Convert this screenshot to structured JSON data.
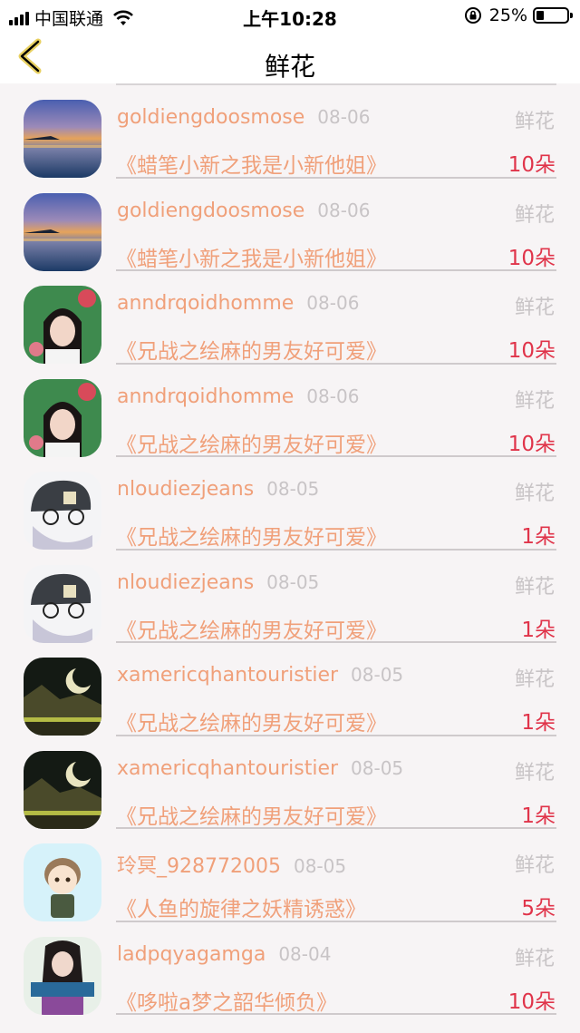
{
  "status": {
    "carrier": "中国联通",
    "time": "上午10:28",
    "battery": "25%",
    "battery_level": 0.25
  },
  "nav": {
    "title": "鲜花"
  },
  "items": [
    {
      "username": "goldiengdoosmose",
      "date": "08-06",
      "type": "鲜花",
      "title": "《蜡笔小新之我是小新他姐》",
      "count": "10朵",
      "avatar": "lake-sunset"
    },
    {
      "username": "goldiengdoosmose",
      "date": "08-06",
      "type": "鲜花",
      "title": "《蜡笔小新之我是小新他姐》",
      "count": "10朵",
      "avatar": "lake-sunset"
    },
    {
      "username": "anndrqoidhomme",
      "date": "08-06",
      "type": "鲜花",
      "title": "《兄战之绘麻的男友好可爱》",
      "count": "10朵",
      "avatar": "girl-flowers"
    },
    {
      "username": "anndrqoidhomme",
      "date": "08-06",
      "type": "鲜花",
      "title": "《兄战之绘麻的男友好可爱》",
      "count": "10朵",
      "avatar": "girl-flowers"
    },
    {
      "username": "nloudiezjeans",
      "date": "08-05",
      "type": "鲜花",
      "title": "《兄战之绘麻的男友好可爱》",
      "count": "1朵",
      "avatar": "anime-boy"
    },
    {
      "username": "nloudiezjeans",
      "date": "08-05",
      "type": "鲜花",
      "title": "《兄战之绘麻的男友好可爱》",
      "count": "1朵",
      "avatar": "anime-boy"
    },
    {
      "username": "xamericqhantouristier",
      "date": "08-05",
      "type": "鲜花",
      "title": "《兄战之绘麻的男友好可爱》",
      "count": "1朵",
      "avatar": "moon-landscape"
    },
    {
      "username": "xamericqhantouristier",
      "date": "08-05",
      "type": "鲜花",
      "title": "《兄战之绘麻的男友好可爱》",
      "count": "1朵",
      "avatar": "moon-landscape"
    },
    {
      "username": "玲冥_928772005",
      "date": "08-05",
      "type": "鲜花",
      "title": "《人鱼的旋律之妖精诱惑》",
      "count": "5朵",
      "avatar": "cartoon-boy"
    },
    {
      "username": "ladpqyagamga",
      "date": "08-04",
      "type": "鲜花",
      "title": "《哆啦a梦之韶华倾负》",
      "count": "10朵",
      "avatar": "girl-sign"
    }
  ]
}
